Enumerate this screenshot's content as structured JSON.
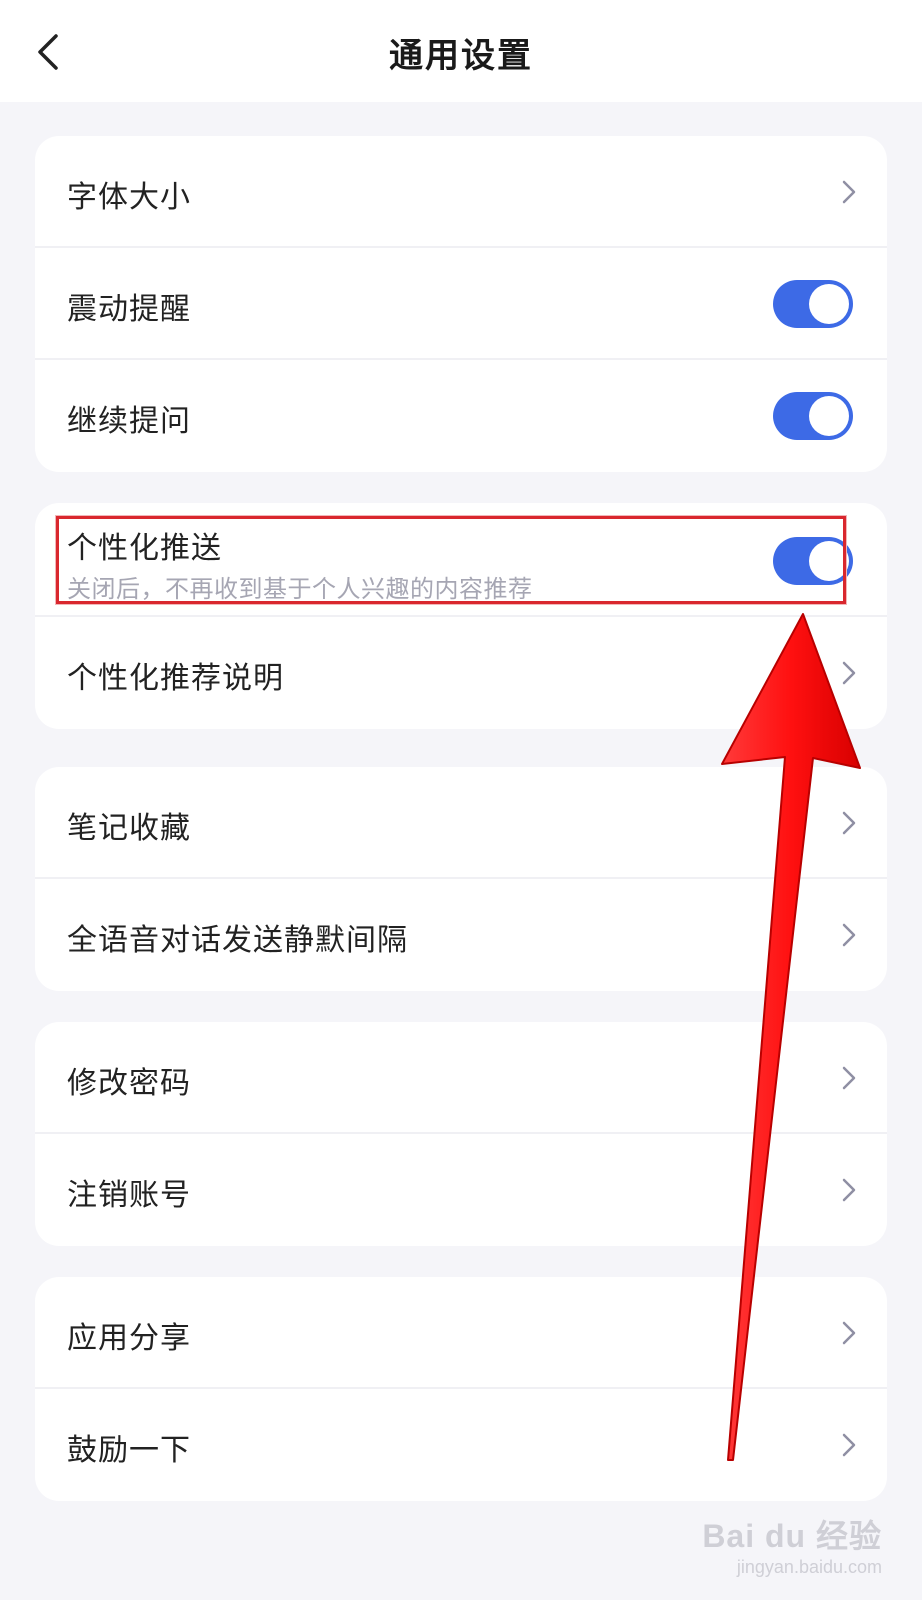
{
  "header": {
    "title": "通用设置",
    "back_icon": "chevron-left-icon"
  },
  "group1": {
    "font_size": {
      "label": "字体大小"
    },
    "vibration": {
      "label": "震动提醒",
      "enabled": true
    },
    "continue_ask": {
      "label": "继续提问",
      "enabled": true
    }
  },
  "group2": {
    "personalized_push": {
      "label": "个性化推送",
      "description": "关闭后，不再收到基于个人兴趣的内容推荐",
      "enabled": true
    },
    "personalized_explain": {
      "label": "个性化推荐说明"
    }
  },
  "group3": {
    "notes": {
      "label": "笔记收藏"
    },
    "voice_silence": {
      "label": "全语音对话发送静默间隔"
    }
  },
  "group4": {
    "change_password": {
      "label": "修改密码"
    },
    "delete_account": {
      "label": "注销账号"
    }
  },
  "group5": {
    "share_app": {
      "label": "应用分享"
    },
    "encourage": {
      "label": "鼓励一下"
    }
  },
  "colors": {
    "toggle_on": "#3d6ae6",
    "highlight": "#d9272e",
    "arrow": "#ff1a1a"
  },
  "watermark": {
    "main": "Bai du 经验",
    "sub": "jingyan.baidu.com"
  }
}
